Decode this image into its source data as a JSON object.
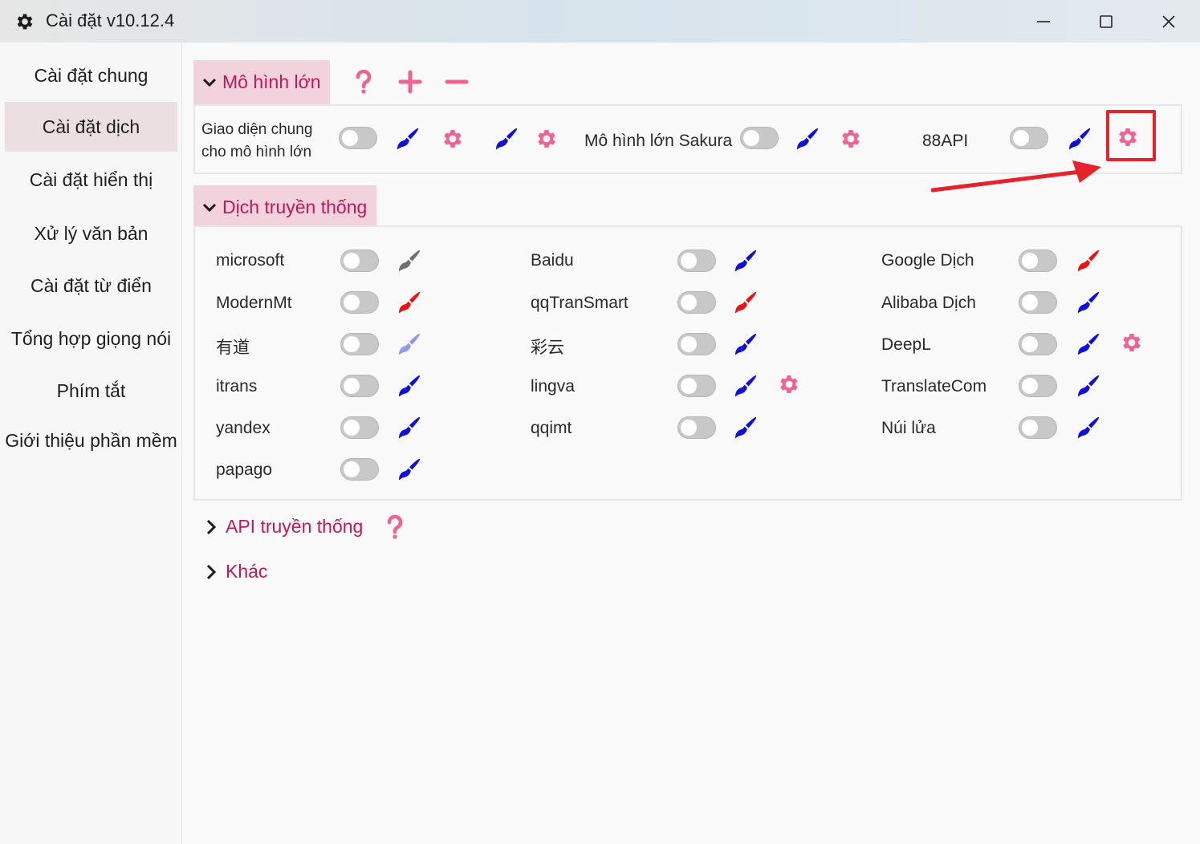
{
  "window": {
    "title": "Cài đặt v10.12.4"
  },
  "sidebar": {
    "items": [
      {
        "label": "Cài đặt chung"
      },
      {
        "label": "Cài đặt dịch"
      },
      {
        "label": "Cài đặt hiển thị"
      },
      {
        "label": "Xử lý văn bản"
      },
      {
        "label": "Cài đặt từ điển"
      },
      {
        "label": "Tổng hợp giọng nói"
      },
      {
        "label": "Phím tắt"
      },
      {
        "label": "Giới thiệu phần mềm"
      }
    ],
    "active": "Cài đặt dịch"
  },
  "llm_section": {
    "title": "Mô hình lớn",
    "general_label": "Giao diện chung cho mô hình lớn",
    "sakura_label": "Mô hình lớn Sakura",
    "api88_label": "88API"
  },
  "traditional_section": {
    "title": "Dịch truyền thống",
    "col1": [
      {
        "label": "microsoft",
        "brush": "gray"
      },
      {
        "label": "ModernMt",
        "brush": "red"
      },
      {
        "label": "有道",
        "brush": "lightblue"
      },
      {
        "label": "itrans",
        "brush": "blue"
      },
      {
        "label": "yandex",
        "brush": "blue"
      },
      {
        "label": "papago",
        "brush": "blue"
      }
    ],
    "col2": [
      {
        "label": "Baidu",
        "brush": "blue"
      },
      {
        "label": "qqTranSmart",
        "brush": "red"
      },
      {
        "label": "彩云",
        "brush": "blue"
      },
      {
        "label": "lingva",
        "brush": "blue",
        "gear": true
      },
      {
        "label": "qqimt",
        "brush": "blue"
      }
    ],
    "col3": [
      {
        "label": "Google Dịch",
        "brush": "red"
      },
      {
        "label": "Alibaba Dịch",
        "brush": "blue"
      },
      {
        "label": "DeepL",
        "brush": "blue",
        "gear": true
      },
      {
        "label": "TranslateCom",
        "brush": "blue"
      },
      {
        "label": "Núi lửa",
        "brush": "blue"
      }
    ]
  },
  "api_section": {
    "title": "API truyền thống"
  },
  "other_section": {
    "title": "Khác"
  },
  "colors": {
    "accent": "#c2185b",
    "gear": "#f06292",
    "brush_blue": "#1010dd",
    "brush_red": "#ee1111",
    "brush_gray": "#707070",
    "brush_lightblue": "#8f9ae8",
    "highlight": "#e5232b"
  },
  "icons": [
    "gear-icon",
    "brush-icon",
    "help-icon",
    "plus-icon",
    "minus-icon",
    "chevron-down-icon",
    "chevron-right-icon",
    "arrow-annotation"
  ]
}
